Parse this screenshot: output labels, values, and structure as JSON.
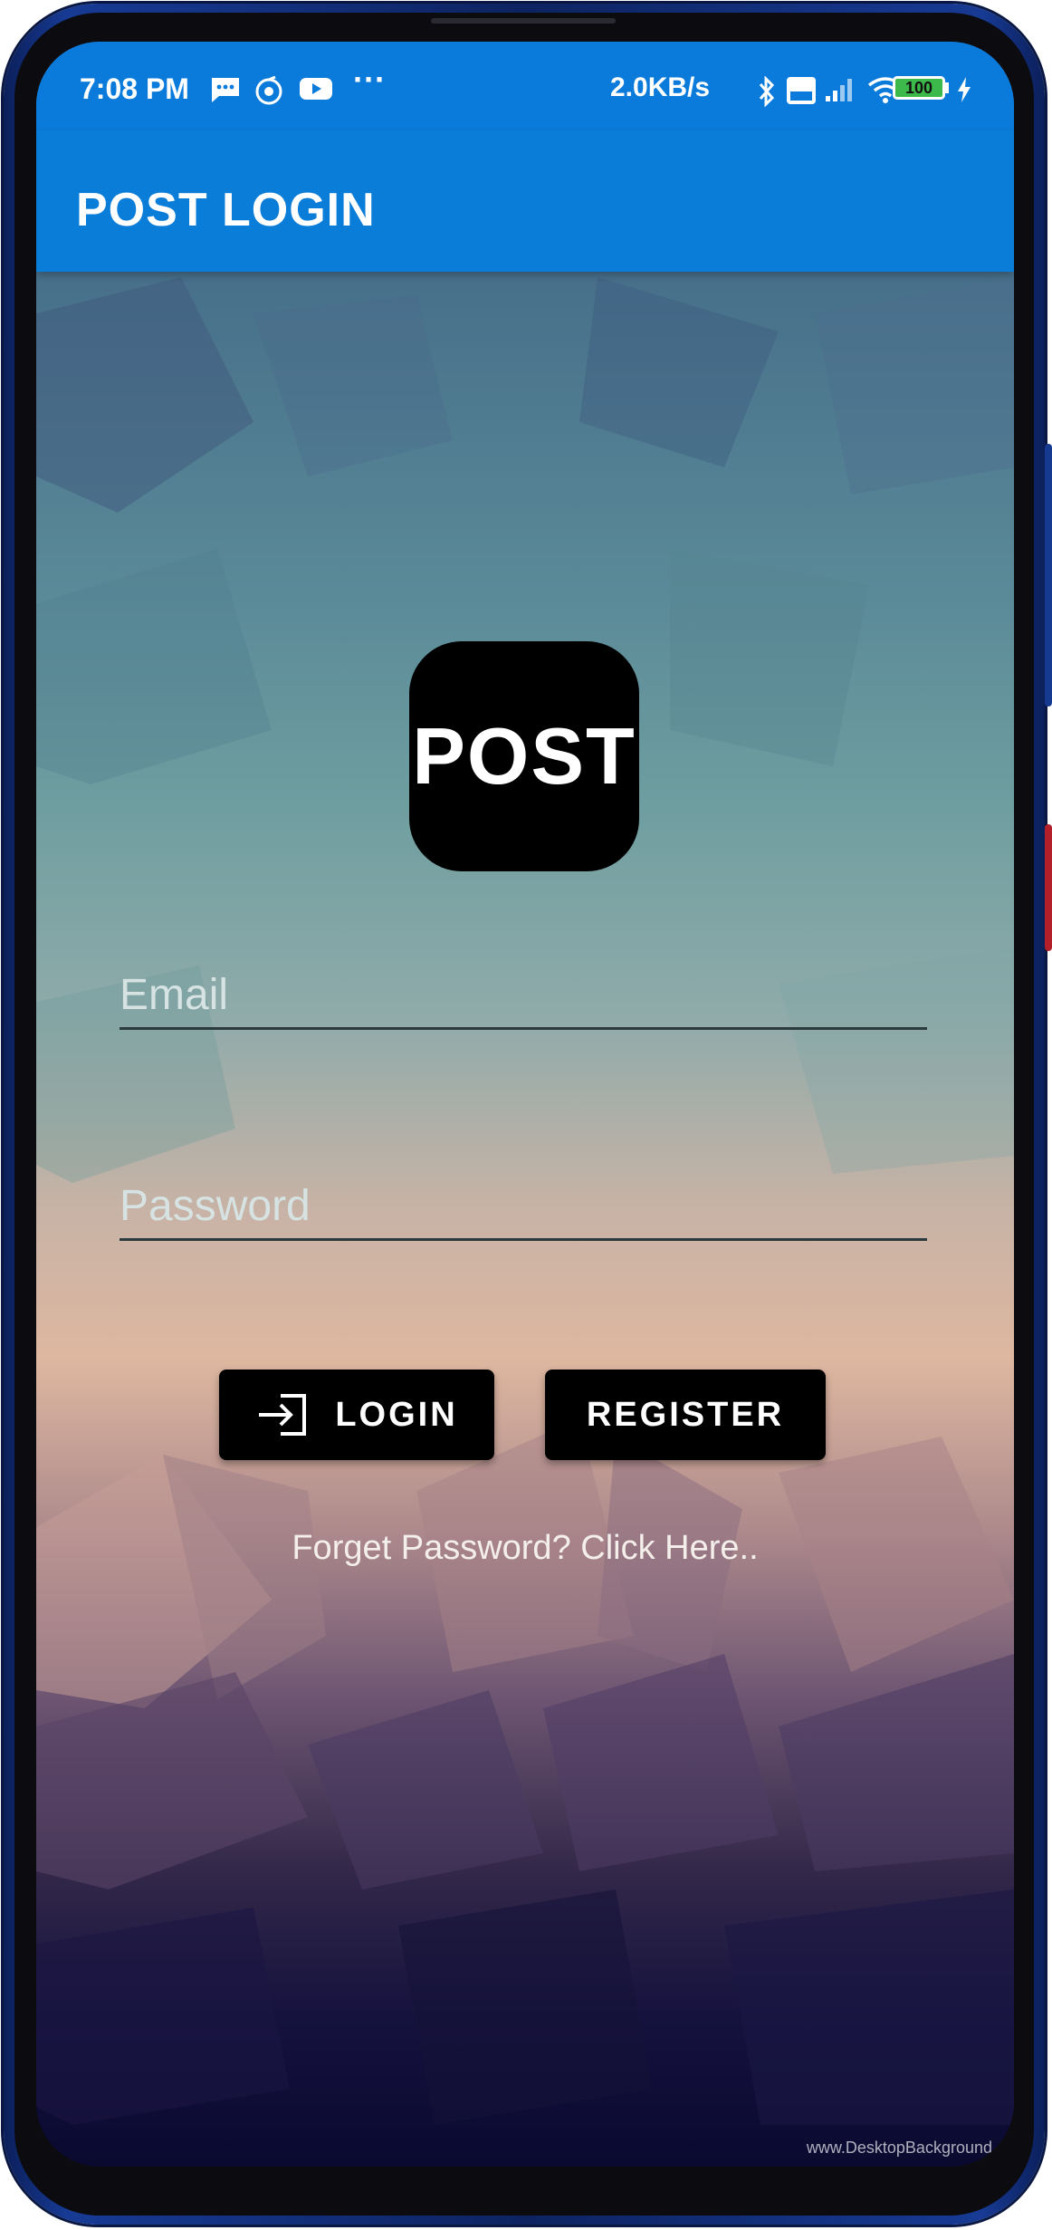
{
  "status_bar": {
    "time": "7:08 PM",
    "icons_left": [
      "message-icon",
      "music-app-icon",
      "youtube-icon",
      "more-icon"
    ],
    "more_label": "···",
    "network_speed": "2.0KB/s",
    "icons_right": [
      "bluetooth-icon",
      "volte-icon",
      "signal-icon",
      "wifi-icon"
    ],
    "battery_level": "100"
  },
  "app_bar": {
    "title": "POST LOGIN"
  },
  "logo": {
    "text": "POST"
  },
  "form": {
    "email_placeholder": "Email",
    "password_placeholder": "Password"
  },
  "buttons": {
    "login": "LOGIN",
    "register": "REGISTER"
  },
  "forgot_password": "Forget Password? Click Here..",
  "watermark": "www.DesktopBackground",
  "colors": {
    "app_bar": "#0a7dd9",
    "button": "#000000",
    "accent_text": "#ffffff"
  }
}
